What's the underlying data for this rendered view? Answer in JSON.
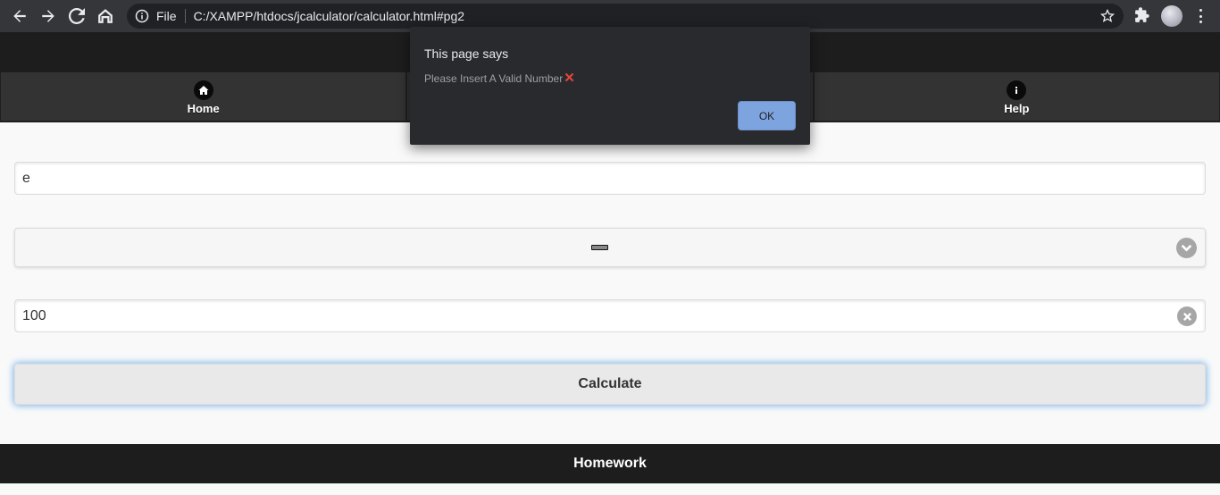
{
  "browser": {
    "file_label": "File",
    "url": "C:/XAMPP/htdocs/jcalculator/calculator.html#pg2"
  },
  "navbar": {
    "items": [
      {
        "label": "Home",
        "icon": "home-icon"
      },
      {
        "label": "",
        "icon": ""
      },
      {
        "label": "Help",
        "icon": "info-icon"
      }
    ]
  },
  "form": {
    "first_number": "e",
    "operator": "minus",
    "second_number": "100",
    "calculate_label": "Calculate"
  },
  "footer": {
    "title": "Homework"
  },
  "dialog": {
    "title": "This page says",
    "message": "Please Insert A Valid Number",
    "message_icon": "cross-mark-icon",
    "ok_label": "OK"
  },
  "colors": {
    "header": "#1d1d1d",
    "navbar": "#333333",
    "dialog_bg": "#292a2d",
    "ok_button": "#7ea4e0",
    "focus_glow": "#7ab3e8",
    "error_mark": "#e8453c"
  }
}
